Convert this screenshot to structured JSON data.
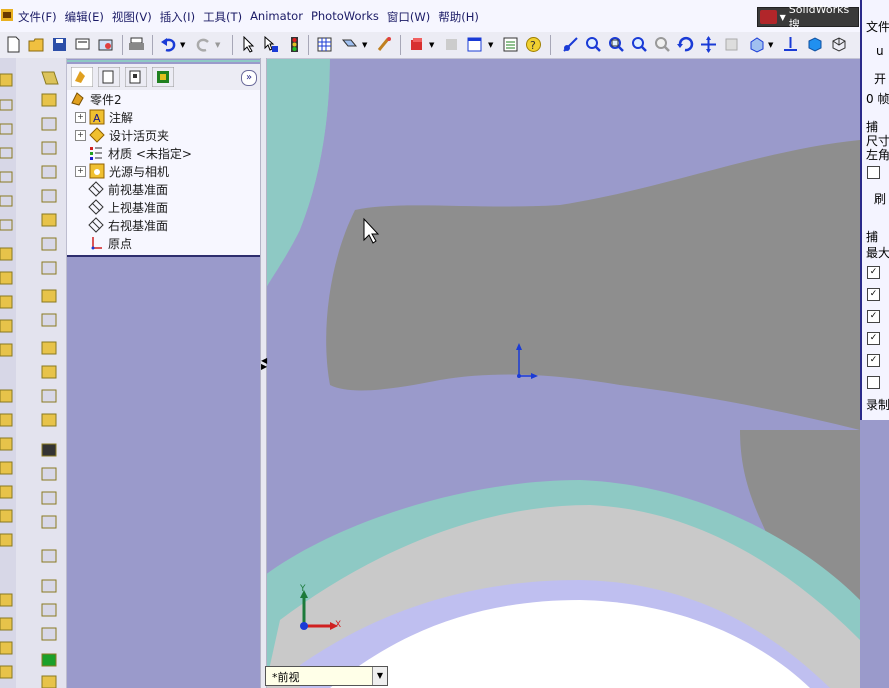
{
  "menubar": {
    "items": [
      "文件(F)",
      "编辑(E)",
      "视图(V)",
      "插入(I)",
      "工具(T)",
      "Animator",
      "PhotoWorks",
      "窗口(W)",
      "帮助(H)"
    ],
    "search_label": "SolidWorks 搜"
  },
  "feature_tree": {
    "root": "零件2",
    "items": [
      {
        "label": "注解",
        "expandable": true,
        "icon": "annotation-icon"
      },
      {
        "label": "设计活页夹",
        "expandable": true,
        "icon": "design-binder-icon"
      },
      {
        "label": "材质 <未指定>",
        "expandable": false,
        "icon": "material-icon"
      },
      {
        "label": "光源与相机",
        "expandable": true,
        "icon": "lights-cameras-icon"
      },
      {
        "label": "前视基准面",
        "expandable": false,
        "icon": "plane-icon"
      },
      {
        "label": "上视基准面",
        "expandable": false,
        "icon": "plane-icon"
      },
      {
        "label": "右视基准面",
        "expandable": false,
        "icon": "plane-icon"
      },
      {
        "label": "原点",
        "expandable": false,
        "icon": "origin-icon"
      }
    ],
    "expand_button": "»"
  },
  "view": {
    "tab_label": "*前视",
    "triad_x": "X",
    "triad_y": "Y"
  },
  "right_panel": {
    "title_fragment": "文件",
    "btn1": "u",
    "start": "开",
    "frames": "0 帧",
    "capture": "捕",
    "size": "尺寸",
    "corner": "左角",
    "refresh": "刷",
    "capture2": "捕",
    "max": "最大",
    "record": "录制"
  },
  "colors": {
    "bg_purple": "#9a9acb",
    "teal": "#8ec9c4",
    "grey": "#8e8e8e",
    "light_grey": "#c9c9c9",
    "white": "#ffffff"
  }
}
